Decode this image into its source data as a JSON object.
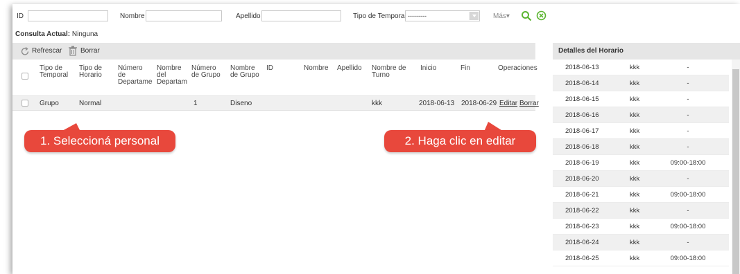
{
  "filter": {
    "id_label": "ID",
    "nombre_label": "Nombre",
    "apellido_label": "Apellido",
    "tipo_label": "Tipo de Temporal",
    "tipo_value": "---------",
    "mas_label": "Más▾"
  },
  "consulta": {
    "label": "Consulta Actual:",
    "value": "Ninguna"
  },
  "toolbar": {
    "refresh": "Refrescar",
    "delete": "Borrar"
  },
  "table": {
    "headers": [
      [
        "Tipo de",
        "Temporal"
      ],
      [
        "Tipo de",
        "Horario"
      ],
      [
        "Número",
        "de",
        "Departame"
      ],
      [
        "Nombre",
        "del",
        "Departam"
      ],
      [
        "Número",
        "de Grupo"
      ],
      [
        "Nombre",
        "de Grupo"
      ],
      [
        "ID"
      ],
      [
        "Nombre"
      ],
      [
        "Apellido"
      ],
      [
        "Nombre de",
        "Turno"
      ],
      [
        "Inicio"
      ],
      [
        "Fin"
      ],
      [
        "Operaciones"
      ]
    ],
    "row": {
      "tipo": "Grupo",
      "horario": "Normal",
      "num_grupo": "1",
      "nombre_grupo": "Diseno",
      "turno": "kkk",
      "inicio": "2018-06-13",
      "fin": "2018-06-29",
      "edit": "Editar",
      "delete": "Borrar"
    }
  },
  "callouts": {
    "step1": "1. Seleccioná personal",
    "step2": "2. Haga clic en editar",
    "color": "#e8483c"
  },
  "detalles": {
    "title": "Detalles del Horario",
    "rows": [
      {
        "date": "2018-06-13",
        "turno": "kkk",
        "time": "-"
      },
      {
        "date": "2018-06-14",
        "turno": "kkk",
        "time": "-"
      },
      {
        "date": "2018-06-15",
        "turno": "kkk",
        "time": "-"
      },
      {
        "date": "2018-06-16",
        "turno": "kkk",
        "time": "-"
      },
      {
        "date": "2018-06-17",
        "turno": "kkk",
        "time": "-"
      },
      {
        "date": "2018-06-18",
        "turno": "kkk",
        "time": "-"
      },
      {
        "date": "2018-06-19",
        "turno": "kkk",
        "time": "09:00-18:00"
      },
      {
        "date": "2018-06-20",
        "turno": "kkk",
        "time": "-"
      },
      {
        "date": "2018-06-21",
        "turno": "kkk",
        "time": "09:00-18:00"
      },
      {
        "date": "2018-06-22",
        "turno": "kkk",
        "time": "-"
      },
      {
        "date": "2018-06-23",
        "turno": "kkk",
        "time": "09:00-18:00"
      },
      {
        "date": "2018-06-24",
        "turno": "kkk",
        "time": "-"
      },
      {
        "date": "2018-06-25",
        "turno": "kkk",
        "time": "09:00-18:00"
      }
    ]
  }
}
